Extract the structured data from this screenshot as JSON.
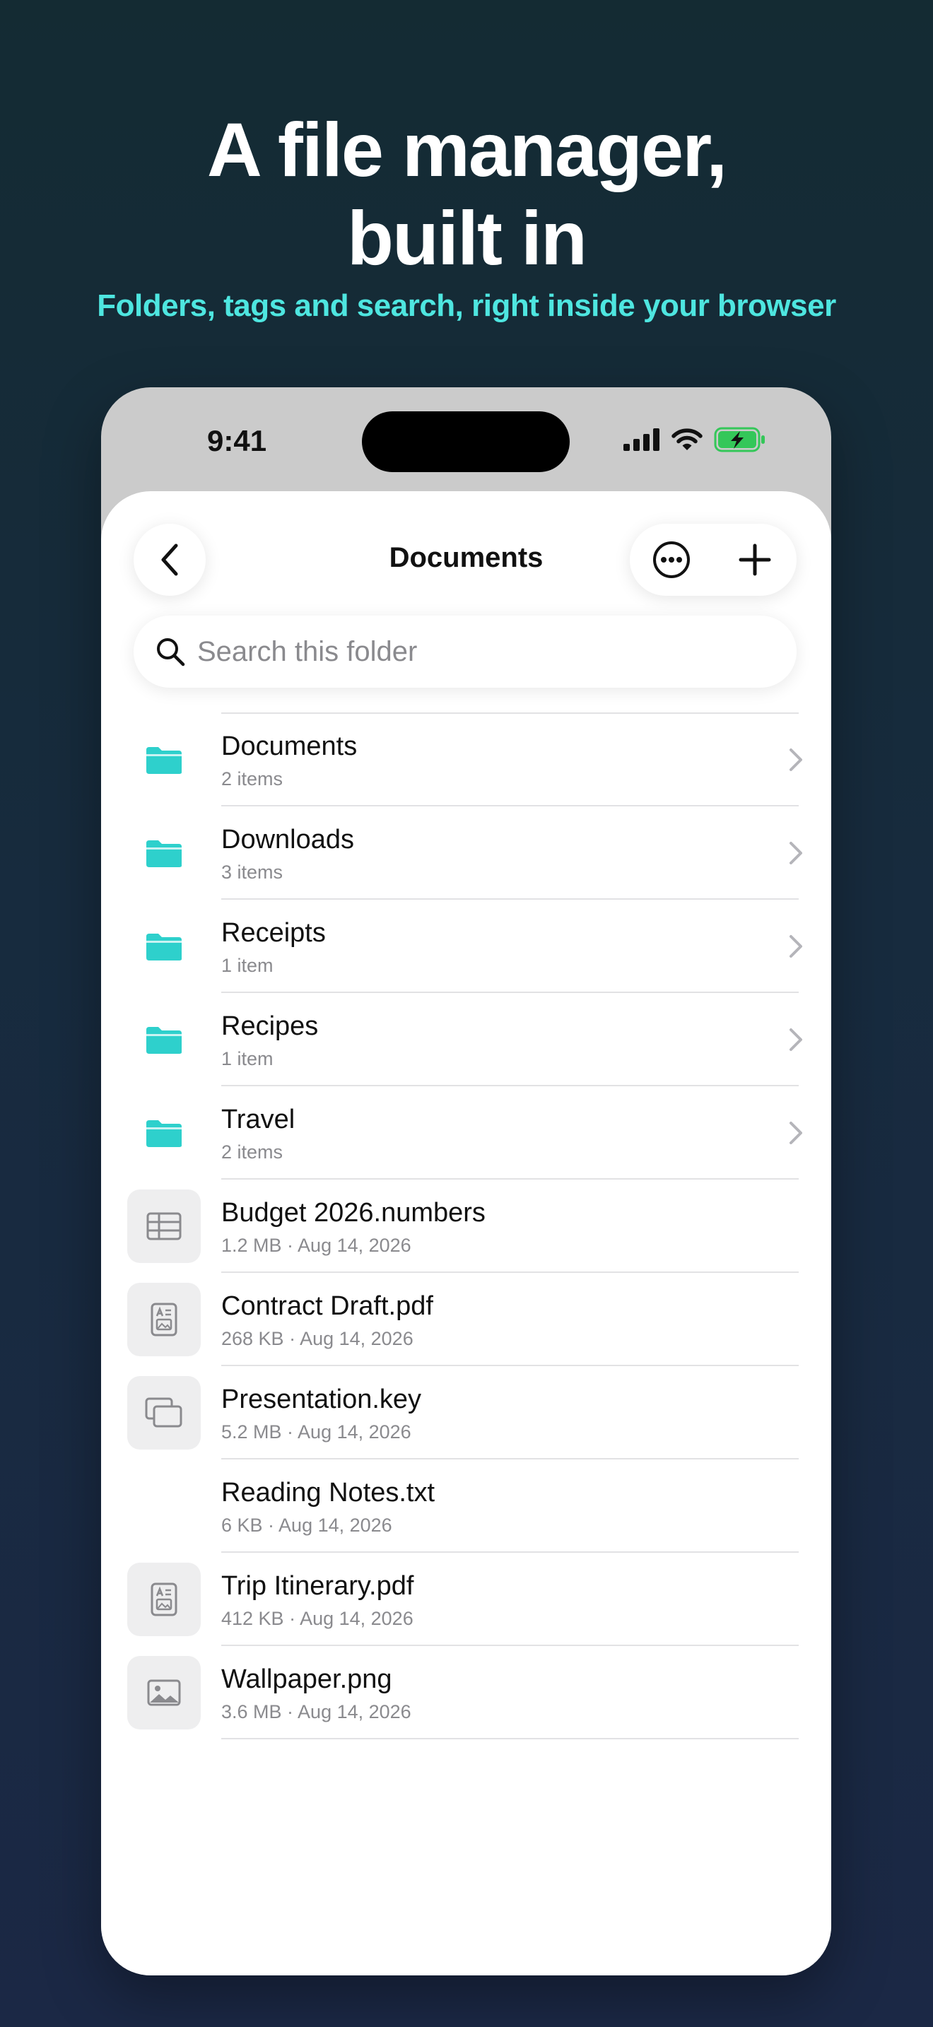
{
  "promo": {
    "headline_line1": "A file manager,",
    "headline_line2": "built in",
    "subhead": "Folders, tags and search, right inside your browser"
  },
  "status_bar": {
    "time": "9:41",
    "icons": [
      "cellular-signal-icon",
      "wifi-icon",
      "battery-charging-icon"
    ]
  },
  "nav": {
    "title": "Documents",
    "back_icon": "chevron-left-icon",
    "more_icon": "ellipsis-circle-icon",
    "add_icon": "plus-icon"
  },
  "search": {
    "placeholder": "Search this folder",
    "value": ""
  },
  "colors": {
    "accent": "#2ed0cc",
    "folder": "#2ed0cc",
    "headline": "#ffffff",
    "subhead": "#4ee6e0"
  },
  "items": [
    {
      "kind": "folder",
      "icon": "folder-icon",
      "name": "Documents",
      "meta": "2 items"
    },
    {
      "kind": "folder",
      "icon": "folder-icon",
      "name": "Downloads",
      "meta": "3 items"
    },
    {
      "kind": "folder",
      "icon": "folder-icon",
      "name": "Receipts",
      "meta": "1 item"
    },
    {
      "kind": "folder",
      "icon": "folder-icon",
      "name": "Recipes",
      "meta": "1 item"
    },
    {
      "kind": "folder",
      "icon": "folder-icon",
      "name": "Travel",
      "meta": "2 items"
    },
    {
      "kind": "file",
      "icon": "spreadsheet-icon",
      "name": "Budget 2026.numbers",
      "meta": "1.2 MB · Aug 14, 2026"
    },
    {
      "kind": "file",
      "icon": "document-icon",
      "name": "Contract Draft.pdf",
      "meta": "268 KB · Aug 14, 2026"
    },
    {
      "kind": "file",
      "icon": "presentation-icon",
      "name": "Presentation.key",
      "meta": "5.2 MB · Aug 14, 2026"
    },
    {
      "kind": "file",
      "icon": "",
      "name": "Reading Notes.txt",
      "meta": "6 KB · Aug 14, 2026"
    },
    {
      "kind": "file",
      "icon": "document-icon",
      "name": "Trip Itinerary.pdf",
      "meta": "412 KB · Aug 14, 2026"
    },
    {
      "kind": "file",
      "icon": "image-icon",
      "name": "Wallpaper.png",
      "meta": "3.6 MB · Aug 14, 2026"
    }
  ]
}
